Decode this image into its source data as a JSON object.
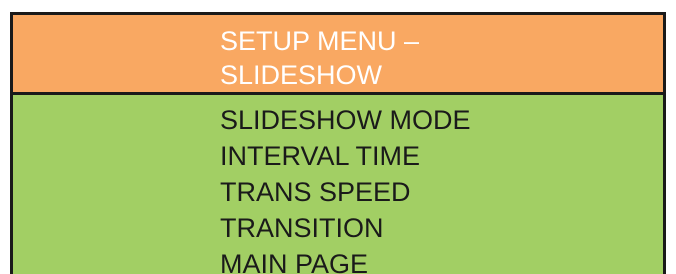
{
  "menu": {
    "title": "SETUP MENU –\nSLIDESHOW",
    "items": [
      {
        "label": "SLIDESHOW MODE"
      },
      {
        "label": "INTERVAL TIME"
      },
      {
        "label": "TRANS SPEED"
      },
      {
        "label": "TRANSITION"
      },
      {
        "label": "MAIN PAGE"
      }
    ]
  },
  "colors": {
    "header_background": "#f9a862",
    "body_background": "#a2cf64",
    "header_text": "#ffffff",
    "item_text": "#1a1a1a",
    "border": "#1a1a1a"
  }
}
